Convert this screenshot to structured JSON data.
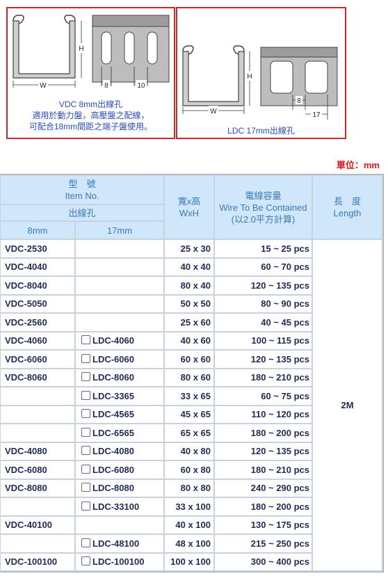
{
  "diagrams": {
    "vdc": {
      "dim_w": "W",
      "dim_h": "H",
      "dim_8": "8",
      "dim_10": "10",
      "caption": [
        "VDC 8mm出線孔",
        "適用於動力盤，高壓盤之配線，",
        "可配合18mm間距之端子盤使用。"
      ]
    },
    "ldc": {
      "dim_w": "W",
      "dim_h": "H",
      "dim_8": "8",
      "dim_17": "17",
      "caption": "LDC 17mm出線孔"
    }
  },
  "unit_label": "單位：mm",
  "table": {
    "headers": {
      "item_zh": "型　號",
      "item_en": "Item No.",
      "hole": "出線孔",
      "h8": "8mm",
      "h17": "17mm",
      "wh_zh": "寬x高",
      "wh_en": "WxH",
      "cap_zh": "電線容量",
      "cap_en": "Wire To Be Contained",
      "cap_note": "(以2.0平方計算)",
      "len_zh": "長　度",
      "len_en": "Length"
    },
    "length_value": "2M",
    "rows": [
      {
        "vdc": "VDC-2530",
        "ldc": "",
        "size": "25 x 30",
        "wire": "15 ~ 25 pcs"
      },
      {
        "vdc": "VDC-4040",
        "ldc": "",
        "size": "40 x 40",
        "wire": "60 ~ 70 pcs"
      },
      {
        "vdc": "VDC-8040",
        "ldc": "",
        "size": "80 x 40",
        "wire": "120 ~ 135 pcs"
      },
      {
        "vdc": "VDC-5050",
        "ldc": "",
        "size": "50 x 50",
        "wire": "80 ~ 90 pcs"
      },
      {
        "vdc": "VDC-2560",
        "ldc": "",
        "size": "25 x 60",
        "wire": "40 ~ 45 pcs"
      },
      {
        "vdc": "VDC-4060",
        "ldc": "LDC-4060",
        "size": "40 x 60",
        "wire": "100 ~ 115 pcs"
      },
      {
        "vdc": "VDC-6060",
        "ldc": "LDC-6060",
        "size": "60 x 60",
        "wire": "120 ~ 135 pcs"
      },
      {
        "vdc": "VDC-8060",
        "ldc": "LDC-8060",
        "size": "80 x 60",
        "wire": "180 ~ 210 pcs"
      },
      {
        "vdc": "",
        "ldc": "LDC-3365",
        "size": "33 x 65",
        "wire": "60 ~ 75 pcs"
      },
      {
        "vdc": "",
        "ldc": "LDC-4565",
        "size": "45 x 65",
        "wire": "110 ~ 120 pcs"
      },
      {
        "vdc": "",
        "ldc": "LDC-6565",
        "size": "65 x 65",
        "wire": "180 ~ 200 pcs"
      },
      {
        "vdc": "VDC-4080",
        "ldc": "LDC-4080",
        "size": "40 x 80",
        "wire": "120 ~ 135 pcs"
      },
      {
        "vdc": "VDC-6080",
        "ldc": "LDC-6080",
        "size": "60 x 80",
        "wire": "180 ~ 210 pcs"
      },
      {
        "vdc": "VDC-8080",
        "ldc": "LDC-8080",
        "size": "80 x 80",
        "wire": "240 ~ 290 pcs"
      },
      {
        "vdc": "",
        "ldc": "LDC-33100",
        "size": "33 x 100",
        "wire": "180 ~ 200 pcs"
      },
      {
        "vdc": "VDC-40100",
        "ldc": "",
        "size": "40 x 100",
        "wire": "130 ~ 175 pcs"
      },
      {
        "vdc": "",
        "ldc": "LDC-48100",
        "size": "48 x 100",
        "wire": "215 ~ 250 pcs"
      },
      {
        "vdc": "VDC-100100",
        "ldc": "LDC-100100",
        "size": "100 x 100",
        "wire": "300 ~ 400 pcs"
      }
    ]
  }
}
